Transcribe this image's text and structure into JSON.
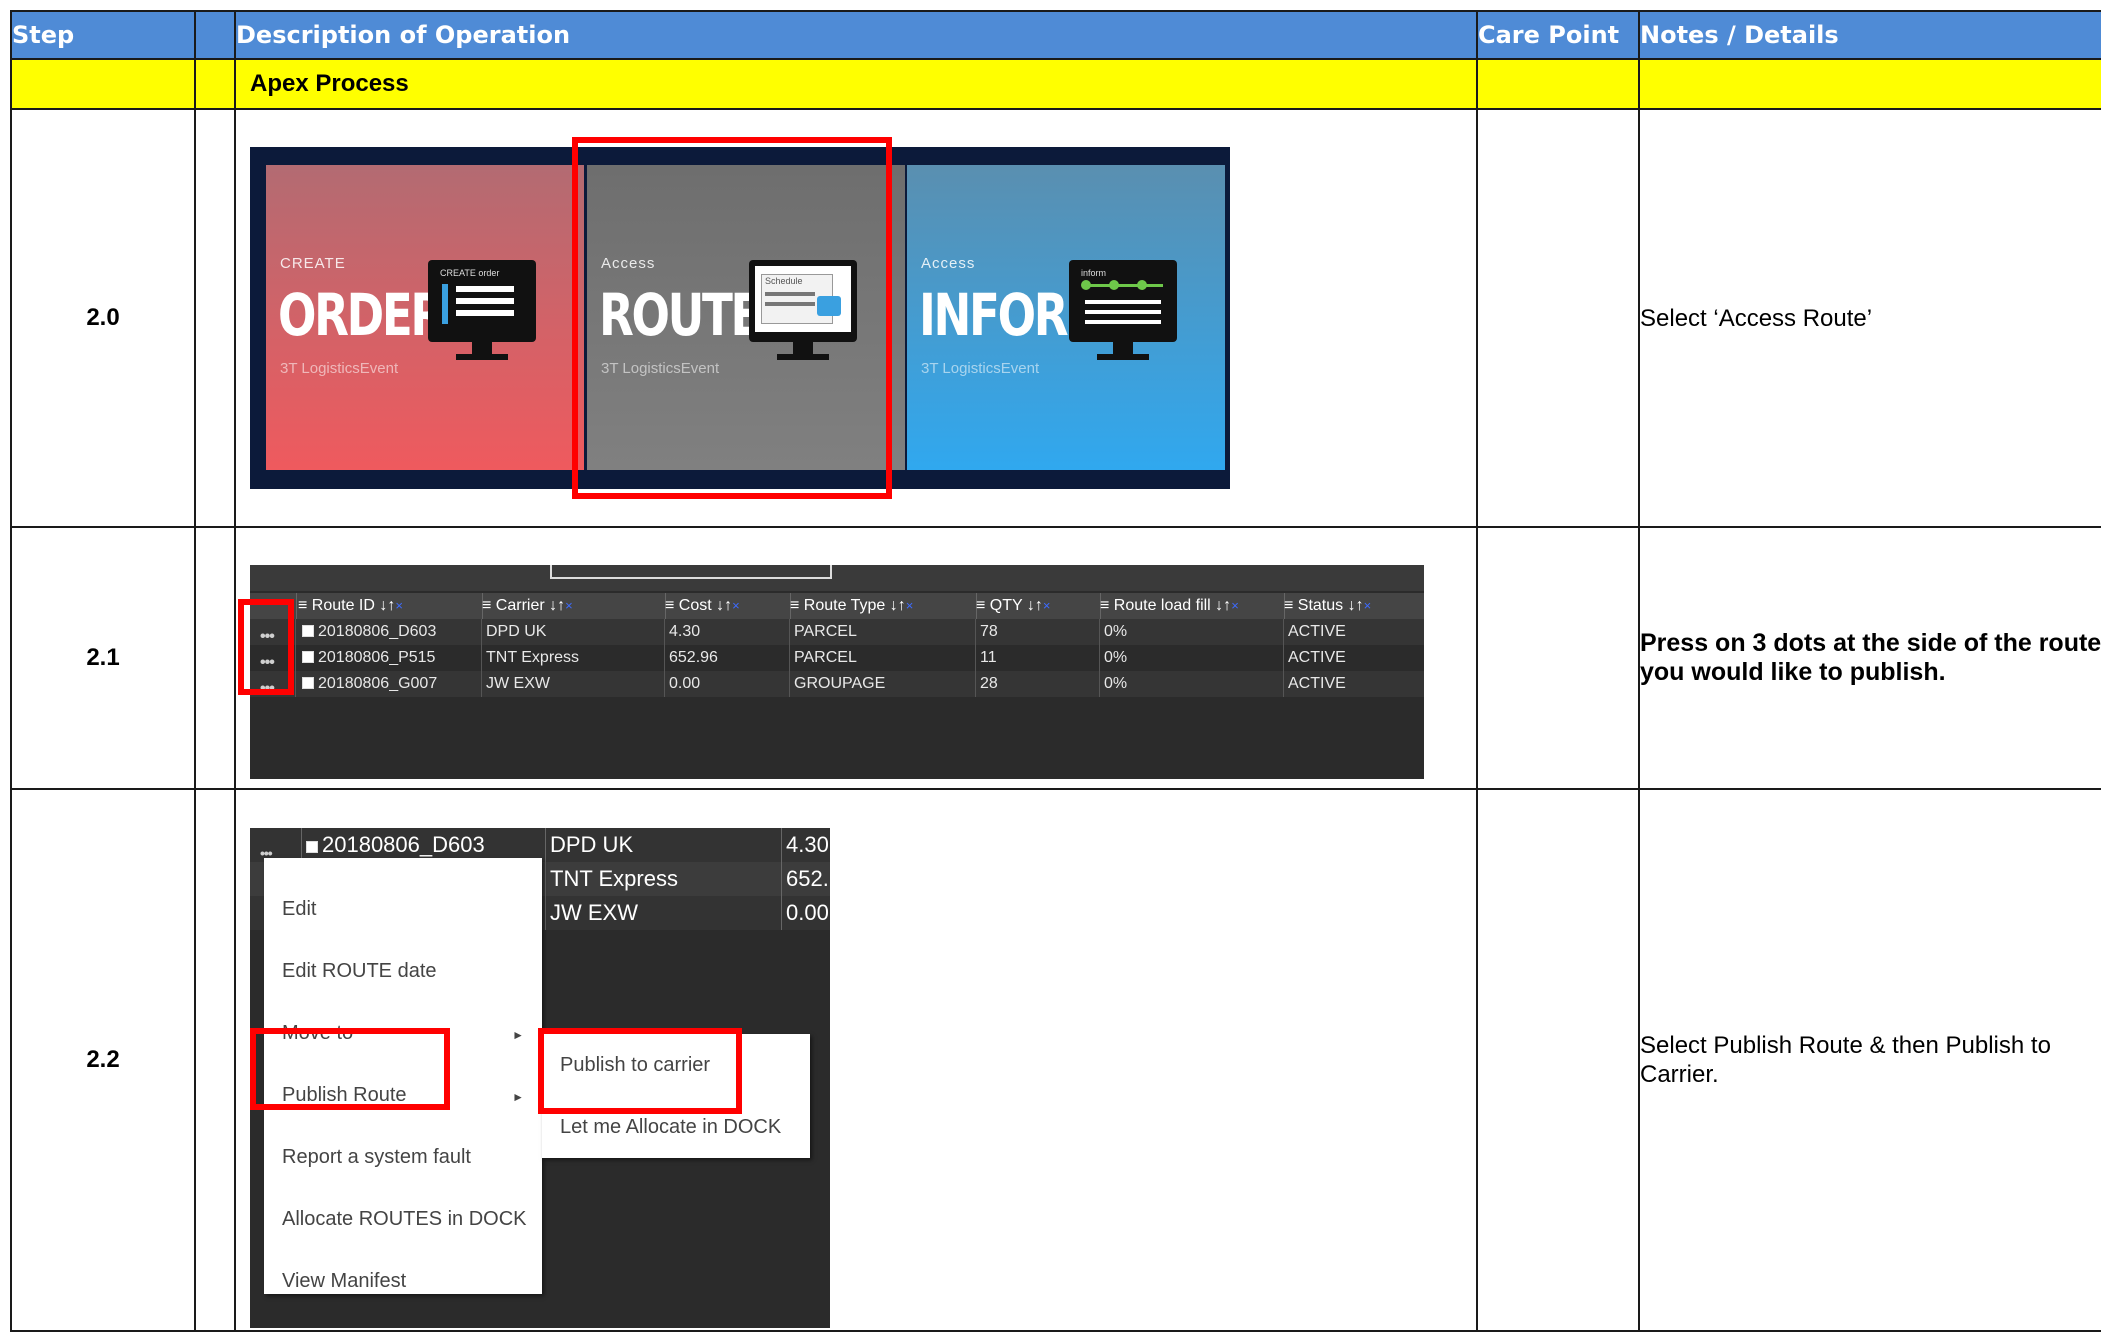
{
  "headers": {
    "step": "Step",
    "blank": "",
    "description": "Description of Operation",
    "care_point": "Care Point",
    "notes": "Notes / Details"
  },
  "section": {
    "title": "Apex Process"
  },
  "rows": {
    "r20": {
      "step": "2.0",
      "notes": "Select ‘Access Route’",
      "tiles": [
        {
          "small": "CREATE",
          "big": "ORDER",
          "foot": "3T LogisticsEvent",
          "screen_label": "CREATE order",
          "color_top": "#b36b72",
          "color_bottom": "#ef5a5e"
        },
        {
          "small": "Access",
          "big": "ROUTE",
          "foot": "3T LogisticsEvent",
          "screen_label": "Schedule",
          "color_top": "#6e6e6e",
          "color_bottom": "#808080"
        },
        {
          "small": "Access",
          "big": "INFORM",
          "foot": "3T LogisticsEvent",
          "screen_label": "inform",
          "color_top": "#5a8fb0",
          "color_bottom": "#30a8ef"
        }
      ]
    },
    "r21": {
      "step": "2.1",
      "notes": "Press on 3 dots at the side of the route you would like to publish.",
      "columns": [
        "Route ID",
        "Carrier",
        "Cost",
        "Route Type",
        "QTY",
        "Route load fill",
        "Status"
      ],
      "rows": [
        [
          "20180806_D603",
          "DPD UK",
          "4.30",
          "PARCEL",
          "78",
          "0%",
          "ACTIVE"
        ],
        [
          "20180806_P515",
          "TNT Express",
          "652.96",
          "PARCEL",
          "11",
          "0%",
          "ACTIVE"
        ],
        [
          "20180806_G007",
          "JW EXW",
          "0.00",
          "GROUPAGE",
          "28",
          "0%",
          "ACTIVE"
        ]
      ]
    },
    "r22": {
      "step": "2.2",
      "notes": "Select Publish Route & then Publish to Carrier.",
      "grid_rows": [
        [
          "20180806_D603",
          "DPD UK",
          "4.30"
        ],
        [
          "",
          "TNT Express",
          "652."
        ],
        [
          "",
          "JW EXW",
          "0.00"
        ]
      ],
      "menu": [
        "Edit",
        "Edit ROUTE date",
        "Move to",
        "Publish Route",
        "Report a system fault",
        "Allocate ROUTES in DOCK",
        "View Manifest"
      ],
      "submenu": [
        "Publish to carrier",
        "Let me Allocate in DOCK"
      ]
    }
  },
  "colors": {
    "header": "#4f8bd6",
    "section": "#ffff00",
    "highlight": "#ff0000"
  }
}
